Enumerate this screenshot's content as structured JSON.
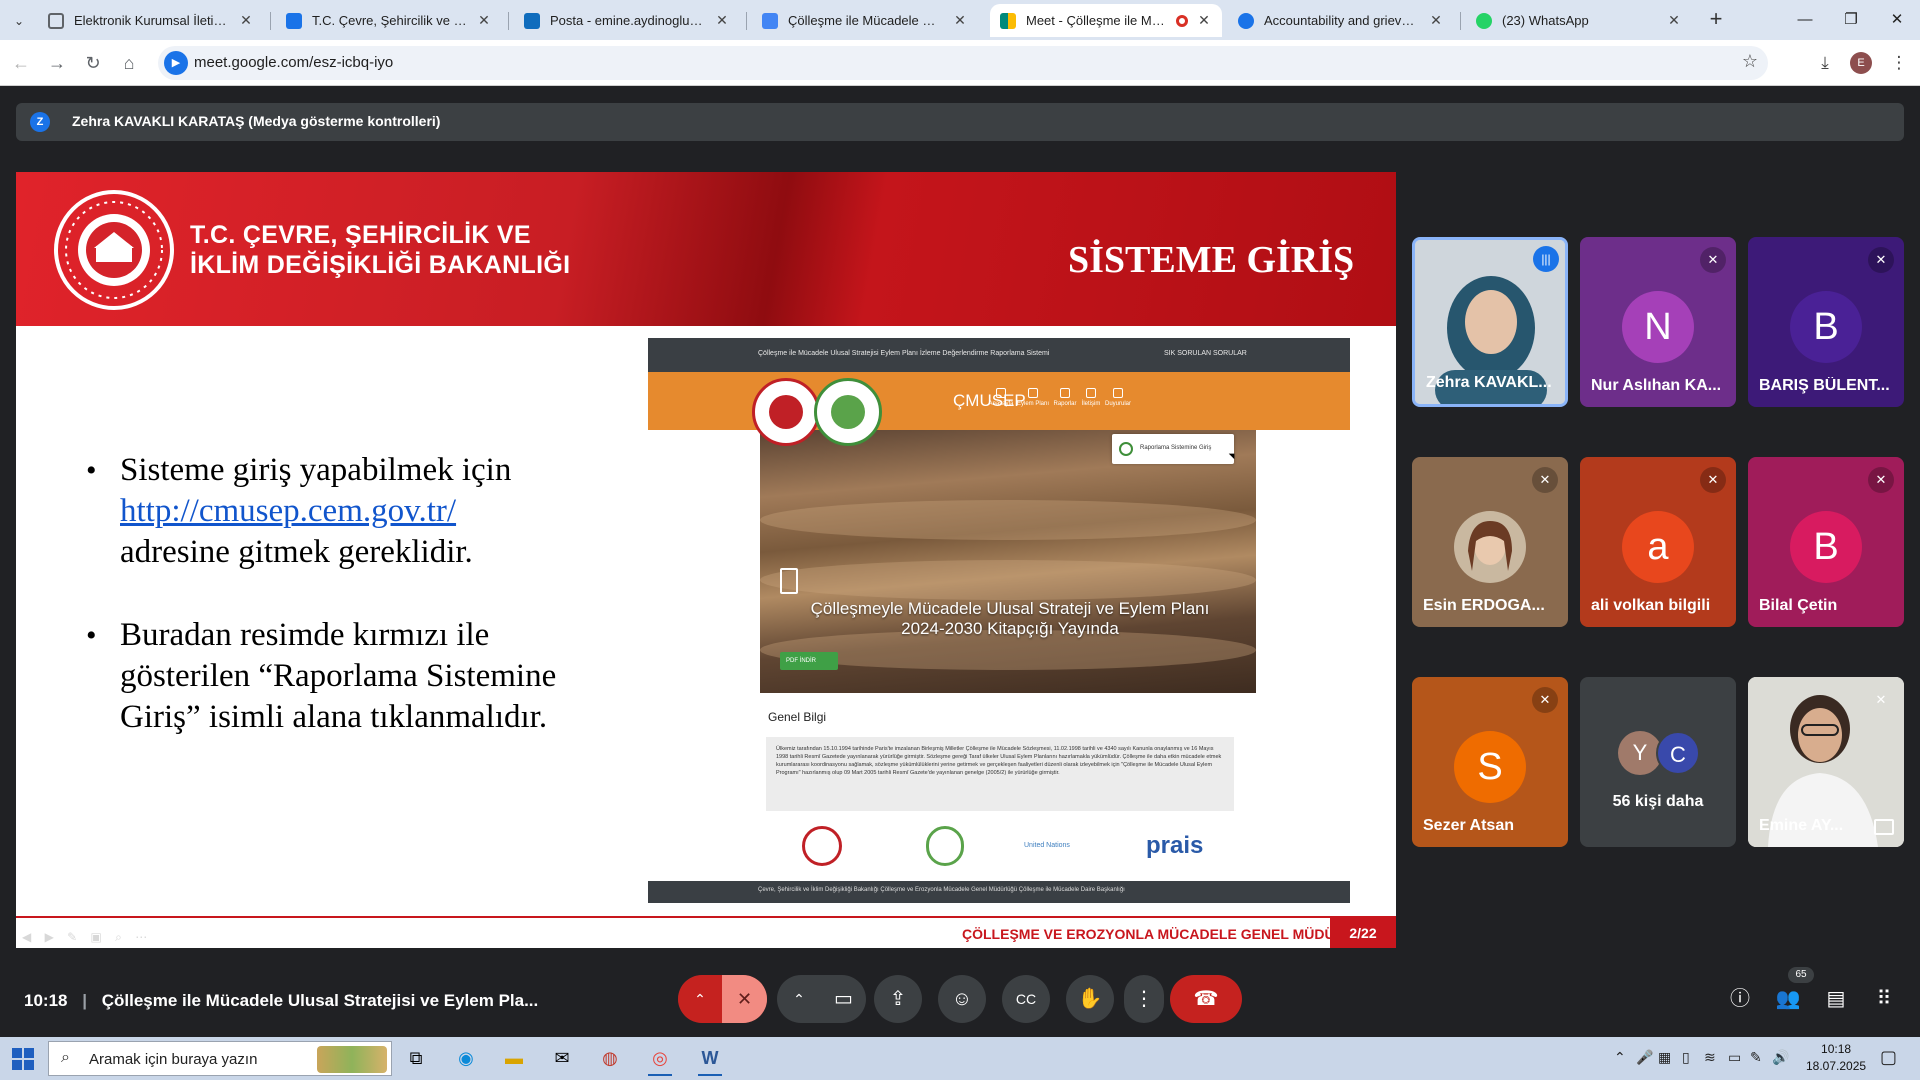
{
  "browser": {
    "tabs": [
      {
        "title": "Elektronik Kurumsal İletişim Pla",
        "color": "#5f6368"
      },
      {
        "title": "T.C. Çevre, Şehircilik ve İklim De",
        "color": "#1a73e8"
      },
      {
        "title": "Posta - emine.aydinoglu@csb.g",
        "color": "#0f6cbd"
      },
      {
        "title": "Çölleşme ile Mücadele Ulusal S",
        "color": "#1a73e8"
      },
      {
        "title": "Meet - Çölleşme ile Mücad",
        "color": "#00897b"
      },
      {
        "title": "Accountability and grievance m",
        "color": "#1a73e8"
      },
      {
        "title": "(23) WhatsApp",
        "color": "#25d366"
      }
    ],
    "url": "meet.google.com/esz-icbq-iyo",
    "profile_initial": "E"
  },
  "meet": {
    "presenter_initial": "Z",
    "presenter_label": "Zehra KAVAKLI KARATAŞ (Medya gösterme kontrolleri)",
    "time": "10:18",
    "meeting_title": "Çölleşme ile Mücadele Ulusal Stratejisi ve Eylem Pla...",
    "participants_count": "65",
    "more_people_initials": [
      "Y",
      "C"
    ],
    "more_people_label": "56 kişi daha"
  },
  "participants": [
    {
      "name": "Zehra KAVAKL...",
      "type": "video",
      "speaking": true
    },
    {
      "name": "Nur Aslıhan KA...",
      "initial": "N",
      "tile_color": "#6d2e8a",
      "avatar_color": "#a540b8"
    },
    {
      "name": "BARIŞ BÜLENT...",
      "initial": "B",
      "tile_color": "#3d1a78",
      "avatar_color": "#4a2196"
    },
    {
      "name": "Esin ERDOGA...",
      "type": "photo",
      "tile_color": "#8a6a4e"
    },
    {
      "name": "ali volkan bilgili",
      "initial": "a",
      "tile_color": "#b33a1c",
      "avatar_color": "#e8471d"
    },
    {
      "name": "Bilal Çetin",
      "initial": "B",
      "tile_color": "#a01c5a",
      "avatar_color": "#d81b60"
    },
    {
      "name": "Sezer Atsan",
      "initial": "S",
      "tile_color": "#b5561a",
      "avatar_color": "#ef6c00"
    },
    {
      "name": "Emine AY...",
      "type": "video"
    }
  ],
  "slide": {
    "ministry_line1": "T.C. ÇEVRE, ŞEHİRCİLİK VE",
    "ministry_line2": "İKLİM DEĞİŞİKLİĞİ BAKANLIĞI",
    "title": "SİSTEME GİRİŞ",
    "bullet1_text": "Sisteme giriş yapabilmek için",
    "bullet1_link": "http://cmusep.cem.gov.tr/",
    "bullet1_tail": "adresine gitmek gereklidir.",
    "bullet2_text": "Buradan resimde kırmızı ile gösterilen “Raporlama Sistemine Giriş” isimli alana tıklanmalıdır.",
    "footer_text": "ÇÖLLEŞME VE EROZYONLA MÜCADELE GENEL MÜDÜRLÜĞÜ",
    "page": "2/22"
  },
  "site": {
    "topbar_left": "Çölleşme ile Mücadele Ulusal Stratejisi Eylem Planı İzleme Değerlendirme Raporlama Sistemi",
    "topbar_right": "SIK SORULAN SORULAR",
    "brand": "ÇMUSEP",
    "menu": [
      "Anasayfa",
      "Eylem Planı",
      "Raporlar",
      "İletişim",
      "Duyurular"
    ],
    "login_label": "Raporlama Sistemine Giriş",
    "hero_title_line1": "Çölleşmeyle Mücadele Ulusal Strateji ve Eylem Planı",
    "hero_title_line2": "2024-2030 Kitapçığı Yayında",
    "pdf_button": "PDF İNDİR",
    "info_heading": "Genel Bilgi",
    "info_text": "Ülkemiz tarafından 15.10.1994 tarihinde Paris'te imzalanan Birleşmiş Milletler Çölleşme ile Mücadele Sözleşmesi, 11.02.1998 tarihli ve 4340 sayılı Kanunla onaylanmış ve 16 Mayıs 1998 tarihli Resmî Gazetede yayınlanarak yürürlüğe girmiştir. Sözleşme gereği Taraf ülkeler Ulusal Eylem Planlarını hazırlamakla yükümlüdür. Çölleşme ile daha etkin mücadele etmek kurumlararası koordinasyonu sağlamak, sözleşme yükümlülüklerini yerine getirmek ve gerçekleşen faaliyetleri düzenli olarak izleyebilmek için \"Çölleşme ile Mücadele Ulusal Eylem Programı\" hazırlanmış olup 09 Mart 2005 tarihli Resmî Gazete'de yayınlanan genelge (2005/2) ile yürürlüğe girmiştir.",
    "logo_un": "United Nations",
    "logo_prais": "prais",
    "footer": "Çevre, Şehircilik ve İklim Değişikliği Bakanlığı Çölleşme ve Erozyonla Mücadele Genel Müdürlüğü Çölleşme ile Mücadele Daire Başkanlığı"
  },
  "taskbar": {
    "search_placeholder": "Aramak için buraya yazın",
    "time": "10:18",
    "date": "18.07.2025"
  }
}
